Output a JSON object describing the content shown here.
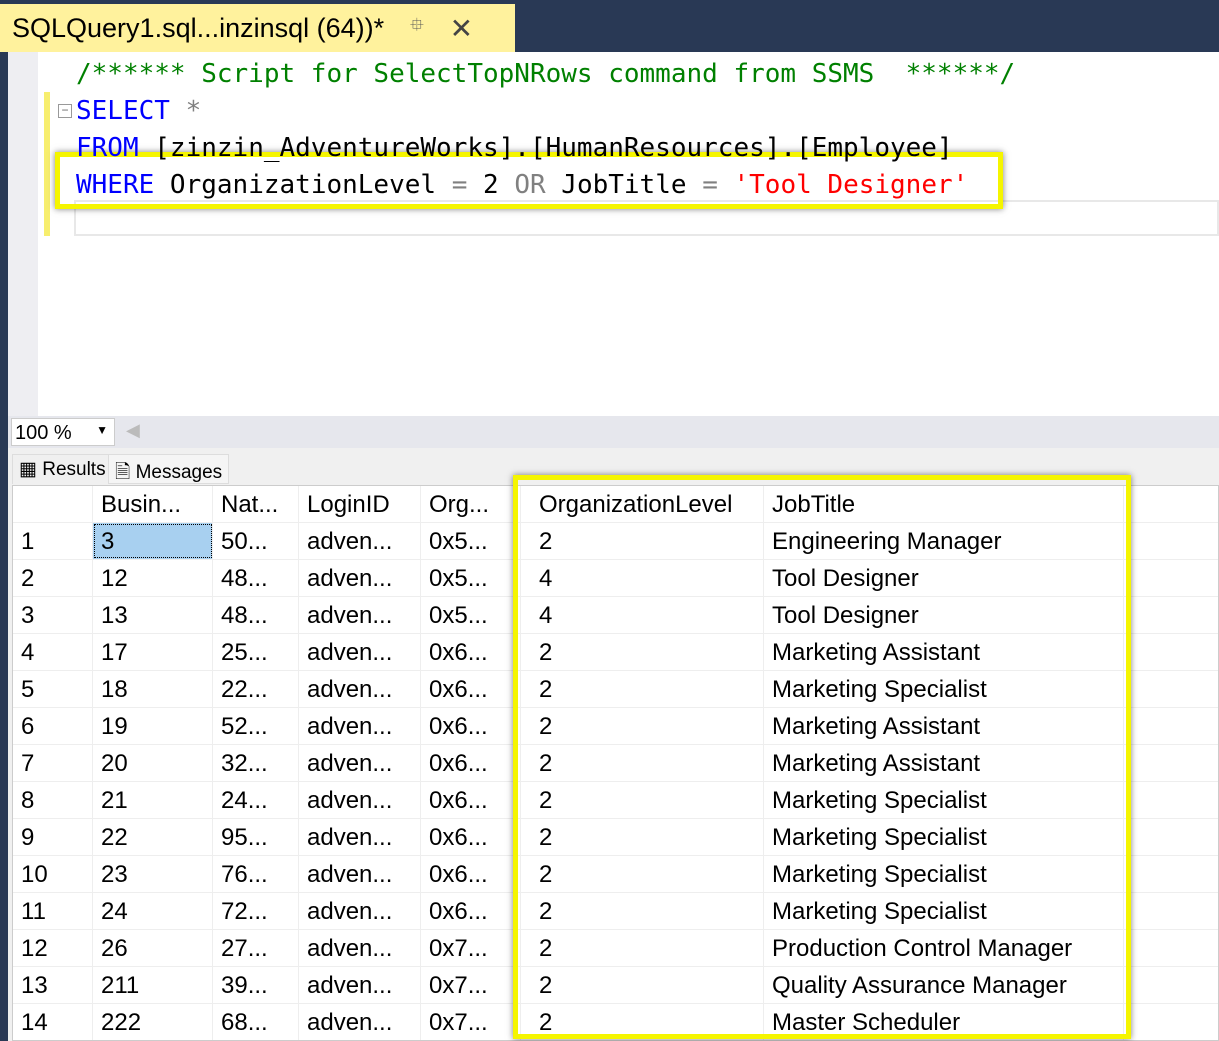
{
  "tab": {
    "title": "SQLQuery1.sql...inzinsql (64))*",
    "pin_icon": "pin-icon",
    "close_icon": "close-icon"
  },
  "editor": {
    "line1": "/****** Script for SelectTopNRows command from SSMS  ******/",
    "line2_kw": "SELECT",
    "line2_rest": " *",
    "line3": "FROM [zinzin_AdventureWorks].[HumanResources].[Employee]",
    "line4": {
      "kw": "WHERE",
      "a": " OrganizationLevel ",
      "eq1": "=",
      "b": " 2 ",
      "or": "OR",
      "c": " JobTitle ",
      "eq2": "=",
      "str": " 'Tool Designer'"
    }
  },
  "zoom": {
    "value": "100 %"
  },
  "results_tabs": [
    {
      "label": "Results"
    },
    {
      "label": "Messages"
    }
  ],
  "grid": {
    "columns": [
      "",
      "Busin...",
      "Nat...",
      "LoginID",
      "Org...",
      "OrganizationLevel",
      "JobTitle"
    ],
    "rows": [
      [
        "1",
        "3",
        "50...",
        "adven...",
        "0x5...",
        "2",
        "Engineering Manager"
      ],
      [
        "2",
        "12",
        "48...",
        "adven...",
        "0x5...",
        "4",
        "Tool Designer"
      ],
      [
        "3",
        "13",
        "48...",
        "adven...",
        "0x5...",
        "4",
        "Tool Designer"
      ],
      [
        "4",
        "17",
        "25...",
        "adven...",
        "0x6...",
        "2",
        "Marketing Assistant"
      ],
      [
        "5",
        "18",
        "22...",
        "adven...",
        "0x6...",
        "2",
        "Marketing Specialist"
      ],
      [
        "6",
        "19",
        "52...",
        "adven...",
        "0x6...",
        "2",
        "Marketing Assistant"
      ],
      [
        "7",
        "20",
        "32...",
        "adven...",
        "0x6...",
        "2",
        "Marketing Assistant"
      ],
      [
        "8",
        "21",
        "24...",
        "adven...",
        "0x6...",
        "2",
        "Marketing Specialist"
      ],
      [
        "9",
        "22",
        "95...",
        "adven...",
        "0x6...",
        "2",
        "Marketing Specialist"
      ],
      [
        "10",
        "23",
        "76...",
        "adven...",
        "0x6...",
        "2",
        "Marketing Specialist"
      ],
      [
        "11",
        "24",
        "72...",
        "adven...",
        "0x6...",
        "2",
        "Marketing Specialist"
      ],
      [
        "12",
        "26",
        "27...",
        "adven...",
        "0x7...",
        "2",
        "Production Control Manager"
      ],
      [
        "13",
        "211",
        "39...",
        "adven...",
        "0x7...",
        "2",
        "Quality Assurance Manager"
      ],
      [
        "14",
        "222",
        "68...",
        "adven...",
        "0x7...",
        "2",
        "Master Scheduler"
      ]
    ]
  },
  "colors": {
    "highlight": "#f5f500",
    "tab": "#fff29d",
    "keyword": "#0000ff",
    "comment": "#008000",
    "string": "#ff0000"
  }
}
